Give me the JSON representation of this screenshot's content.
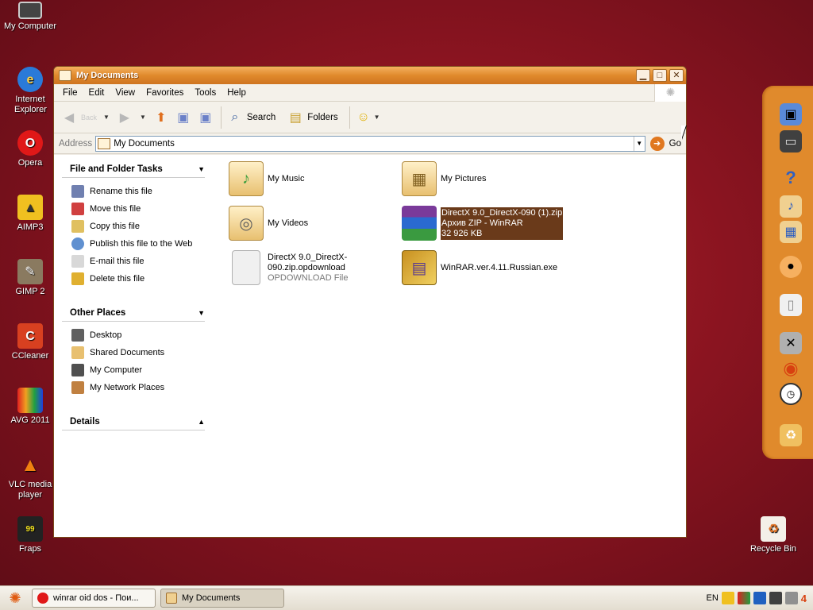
{
  "desktop": {
    "icons": [
      {
        "label": "My Computer",
        "icon": "my-computer-icon"
      },
      {
        "label": "Internet Explorer",
        "icon": "internet-explorer-icon"
      },
      {
        "label": "Opera",
        "icon": "opera-icon"
      },
      {
        "label": "AIMP3",
        "icon": "aimp-icon"
      },
      {
        "label": "GIMP 2",
        "icon": "gimp-icon"
      },
      {
        "label": "CCleaner",
        "icon": "ccleaner-icon"
      },
      {
        "label": "AVG 2011",
        "icon": "avg-icon"
      },
      {
        "label": "VLC media player",
        "icon": "vlc-icon"
      },
      {
        "label": "Fraps",
        "icon": "fraps-icon"
      },
      {
        "label": "Recycle Bin",
        "icon": "recycle-bin-icon"
      }
    ]
  },
  "window": {
    "title": "My Documents",
    "controls": {
      "minimize": "▁",
      "maximize": "□",
      "close": "✕"
    }
  },
  "menu": [
    "File",
    "Edit",
    "View",
    "Favorites",
    "Tools",
    "Help"
  ],
  "toolbar": {
    "back_label": "Back",
    "search_label": "Search",
    "folders_label": "Folders"
  },
  "address": {
    "label": "Address",
    "value": "My Documents",
    "go_label": "Go"
  },
  "tasks": {
    "file_tasks": {
      "title": "File and Folder Tasks",
      "items": [
        "Rename this file",
        "Move this file",
        "Copy this file",
        "Publish this file to the Web",
        "E-mail this file",
        "Delete this file"
      ]
    },
    "other_places": {
      "title": "Other Places",
      "items": [
        "Desktop",
        "Shared Documents",
        "My Computer",
        "My Network Places"
      ]
    },
    "details": {
      "title": "Details"
    }
  },
  "files": [
    {
      "name": "My Music",
      "type": "folder"
    },
    {
      "name": "My Pictures",
      "type": "folder"
    },
    {
      "name": "My Videos",
      "type": "folder"
    },
    {
      "name": "DirectX 9.0_DirectX-090 (1).zip",
      "line2": "Архив ZIP - WinRAR",
      "line3": "32 926 KB",
      "type": "zip",
      "selected": true
    },
    {
      "name": "DirectX 9.0_DirectX-090.zip.opdownload",
      "line2": "OPDOWNLOAD File",
      "type": "file"
    },
    {
      "name": "WinRAR.ver.4.11.Russian.exe",
      "type": "exe"
    }
  ],
  "taskbar": {
    "tasks": [
      "winrar oid dos - Пои...",
      "My Documents"
    ],
    "tray_lang": "EN",
    "tray_num": "4"
  },
  "colors": {
    "accent": "#e08a2c",
    "selection": "#6a3a1a",
    "desktop": "#8a1420"
  }
}
